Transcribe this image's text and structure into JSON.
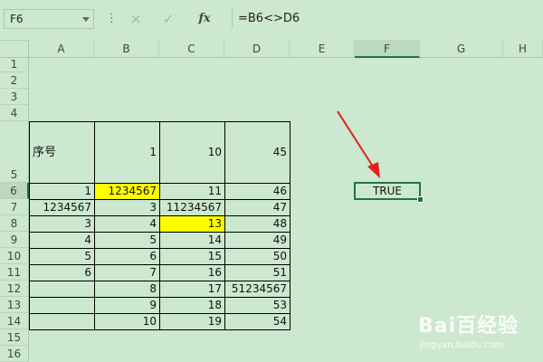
{
  "namebox": {
    "value": "F6"
  },
  "formula": {
    "value": "=B6<>D6"
  },
  "toolbar": {
    "cancel_icon": "×",
    "confirm_icon": "✓",
    "fx_label": "fx",
    "more_icon": "⋮"
  },
  "columns": [
    "A",
    "B",
    "C",
    "D",
    "E",
    "F",
    "G",
    "H"
  ],
  "active_column": "F",
  "rows": [
    "1",
    "2",
    "3",
    "4",
    "5",
    "6",
    "7",
    "8",
    "9",
    "10",
    "11",
    "12",
    "13",
    "14",
    "15",
    "16"
  ],
  "active_row": "6",
  "table": {
    "header": {
      "a": "序号",
      "b": "1",
      "c": "10",
      "d": "45"
    },
    "r6": {
      "a": "1",
      "b": "1234567",
      "c": "11",
      "d": "46"
    },
    "r7": {
      "a": "1234567",
      "b": "3",
      "c": "11234567",
      "d": "47"
    },
    "r8": {
      "a": "3",
      "b": "4",
      "c": "13",
      "d": "48"
    },
    "r9": {
      "a": "4",
      "b": "5",
      "c": "14",
      "d": "49"
    },
    "r10": {
      "a": "5",
      "b": "6",
      "c": "15",
      "d": "50"
    },
    "r11": {
      "a": "6",
      "b": "7",
      "c": "16",
      "d": "51"
    },
    "r12": {
      "a": "",
      "b": "8",
      "c": "17",
      "d": "51234567"
    },
    "r13": {
      "a": "",
      "b": "9",
      "c": "18",
      "d": "53"
    },
    "r14": {
      "a": "",
      "b": "10",
      "c": "19",
      "d": "54"
    }
  },
  "selected_cell": {
    "value": "TRUE"
  },
  "highlight_color": "#ffff00",
  "watermark": {
    "brand": "Bai百经验",
    "url": "jingyan.baidu.com"
  }
}
